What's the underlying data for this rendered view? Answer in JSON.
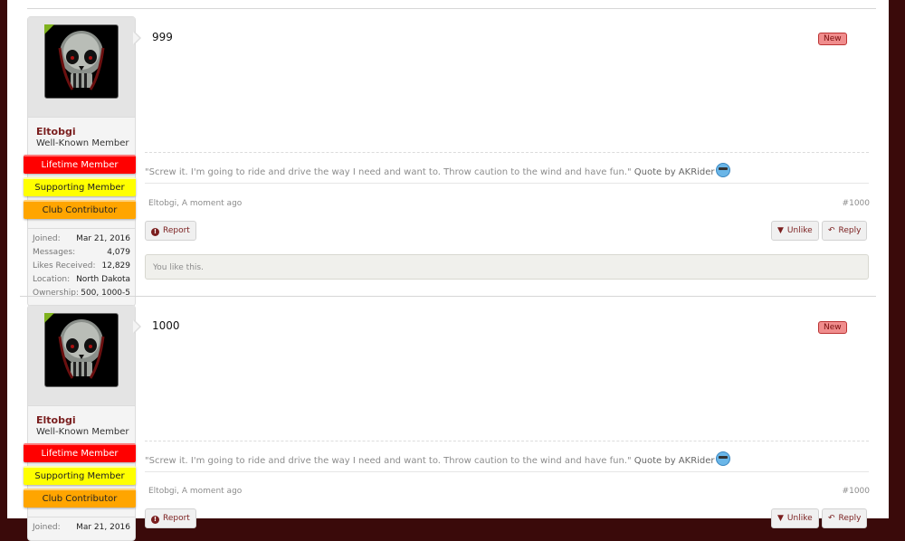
{
  "posts": [
    {
      "username": "Eltobgi",
      "user_title": "Well-Known Member",
      "banners": [
        "Lifetime Member",
        "Supporting Member",
        "Club Contributor"
      ],
      "stats": [
        {
          "label": "Joined:",
          "value": "Mar 21, 2016"
        },
        {
          "label": "Messages:",
          "value": "4,079"
        },
        {
          "label": "Likes Received:",
          "value": "12,829"
        },
        {
          "label": "Location:",
          "value": "North Dakota"
        },
        {
          "label": "Ownership:",
          "value": "500, 1000-5"
        }
      ],
      "message": "999",
      "badge": "New",
      "signature_quote": "\"Screw it. I'm going to ride and drive the way I need and want to. Throw caution to the wind and have fun.\"",
      "signature_by": "Quote by AKRider",
      "author_meta": "Eltobgi, A moment ago",
      "post_number": "#1000",
      "report_label": "Report",
      "unlike_label": "Unlike",
      "reply_label": "Reply",
      "likes_text": "You like this."
    },
    {
      "username": "Eltobgi",
      "user_title": "Well-Known Member",
      "banners": [
        "Lifetime Member",
        "Supporting Member",
        "Club Contributor"
      ],
      "stats": [
        {
          "label": "Joined:",
          "value": "Mar 21, 2016"
        }
      ],
      "message": "1000",
      "badge": "New",
      "signature_quote": "\"Screw it. I'm going to ride and drive the way I need and want to. Throw caution to the wind and have fun.\"",
      "signature_by": "Quote by AKRider",
      "author_meta": "Eltobgi, A moment ago",
      "post_number": "#1000",
      "report_label": "Report",
      "unlike_label": "Unlike",
      "reply_label": "Reply"
    }
  ],
  "colors": {
    "username": "#7a1e1e",
    "lifetime_banner": "#ff0000",
    "supporting_banner": "#ffff00",
    "contributor_banner": "#ffa500",
    "new_badge": "#f08d8d",
    "online_indicator": "#7fb21e"
  },
  "icons": {
    "report": "report-icon",
    "unlike": "thumbs-down-icon",
    "reply": "reply-arrow-icon",
    "signature_emoji": "cool-smiley-icon"
  }
}
